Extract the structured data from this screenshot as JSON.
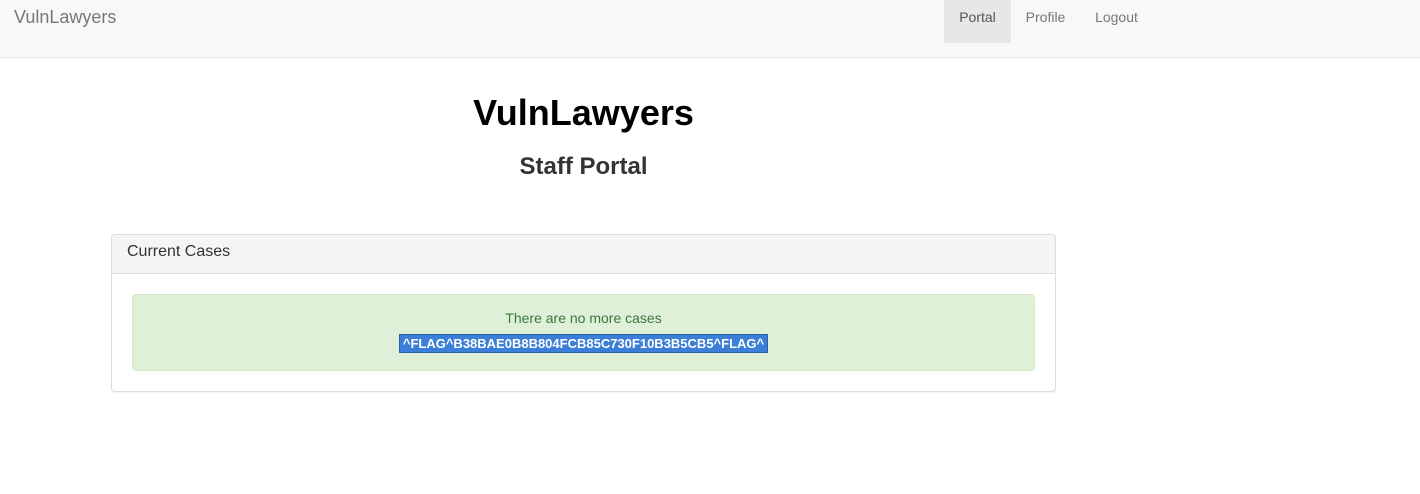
{
  "navbar": {
    "brand": "VulnLawyers",
    "items": [
      {
        "label": "Portal",
        "active": true
      },
      {
        "label": "Profile",
        "active": false
      },
      {
        "label": "Logout",
        "active": false
      }
    ]
  },
  "header": {
    "title": "VulnLawyers",
    "subtitle": "Staff Portal"
  },
  "cases_panel": {
    "heading": "Current Cases",
    "message": "There are no more cases",
    "flag": "^FLAG^B38BAE0B8B804FCB85C730F10B3B5CB5^FLAG^"
  },
  "colors": {
    "alert_bg": "#dff0d8",
    "alert_text": "#3c763d",
    "selection": "#3b7fd9"
  }
}
